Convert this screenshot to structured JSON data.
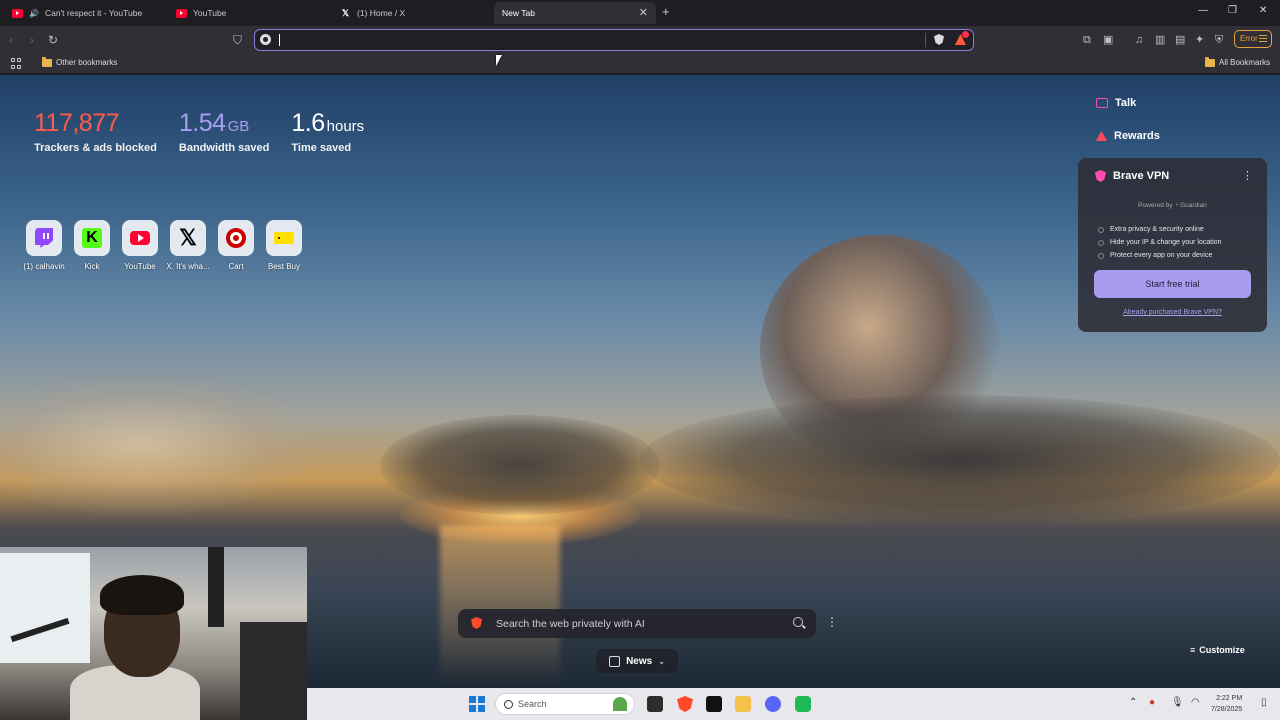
{
  "tabs": [
    {
      "title": "Can't respect it - YouTube",
      "favicon": "youtube-icon",
      "audio": true
    },
    {
      "title": "YouTube",
      "favicon": "youtube-icon"
    },
    {
      "title": "(1) Home / X",
      "favicon": "x-icon"
    },
    {
      "title": "New Tab",
      "active": true
    }
  ],
  "toolbar": {
    "address_value": "",
    "error_label": "Error"
  },
  "bookmarks": {
    "other": "Other bookmarks",
    "all": "All Bookmarks"
  },
  "stats": [
    {
      "value": "117,877",
      "unit": "",
      "label": "Trackers & ads blocked",
      "color": "#ff5a4a"
    },
    {
      "value": "1.54",
      "unit": "GB",
      "label": "Bandwidth saved",
      "color": "#a79ff0"
    },
    {
      "value": "1.6",
      "unit": "hours",
      "label": "Time saved",
      "color": "#ffffff"
    }
  ],
  "top_sites": [
    {
      "label": "(1) calhavin",
      "icon": "twitch-icon"
    },
    {
      "label": "Kick",
      "icon": "kick-icon"
    },
    {
      "label": "YouTube",
      "icon": "youtube-icon"
    },
    {
      "label": "X. It's wha...",
      "icon": "x-icon"
    },
    {
      "label": "Cart",
      "icon": "target-icon"
    },
    {
      "label": "Best Buy",
      "icon": "bestbuy-icon"
    }
  ],
  "right_panel": {
    "talk": "Talk",
    "rewards": "Rewards",
    "vpn": {
      "title": "Brave VPN",
      "powered_by": "Powered by",
      "powered_brand": "Guardian",
      "features": [
        "Extra privacy & security online",
        "Hide your IP & change your location",
        "Protect every app on your device"
      ],
      "cta": "Start free trial",
      "already": "Already purchased Brave VPN?"
    }
  },
  "search": {
    "placeholder": "Search the web privately with AI"
  },
  "news": "News",
  "customize": "Customize",
  "taskbar": {
    "search": "Search",
    "time": "2:22 PM",
    "date": "7/28/2025"
  },
  "colors": {
    "accent": "#8b7ad6",
    "brave": "#ff4a2a",
    "vpn_button": "#a99cf0"
  }
}
